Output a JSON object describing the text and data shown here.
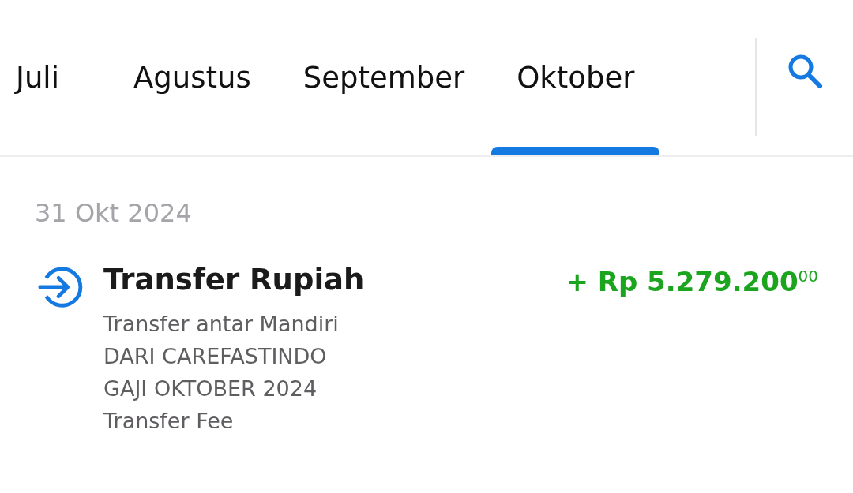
{
  "tabs": [
    {
      "label": "Juli",
      "selected": false
    },
    {
      "label": "Agustus",
      "selected": false
    },
    {
      "label": "September",
      "selected": false
    },
    {
      "label": "Oktober",
      "selected": true
    }
  ],
  "groups": [
    {
      "date": "31 Okt 2024",
      "transactions": [
        {
          "kind": "incoming",
          "title": "Transfer Rupiah",
          "amount": "+ Rp 5.279.200$^{00}$",
          "details": [
            "Transfer antar Mandiri",
            "DARI CAREFASTINDO",
            "GAJI OKTOBER 2024",
            "Transfer Fee"
          ]
        }
      ]
    }
  ]
}
